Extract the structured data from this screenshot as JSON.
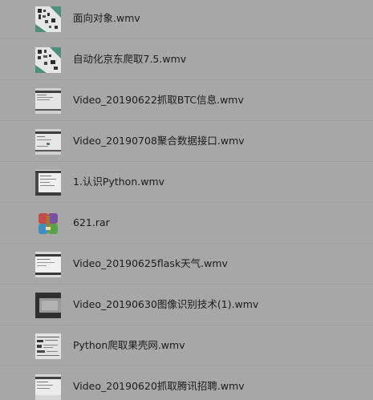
{
  "files": [
    {
      "name": "面向对象.wmv",
      "icon": "video-thumbnail-icon"
    },
    {
      "name": "自动化京东爬取7.5.wmv",
      "icon": "video-thumbnail-icon"
    },
    {
      "name": "Video_20190622抓取BTC信息.wmv",
      "icon": "video-thumbnail-icon"
    },
    {
      "name": "Video_20190708聚合数据接口.wmv",
      "icon": "video-thumbnail-icon"
    },
    {
      "name": "1.认识Python.wmv",
      "icon": "video-thumbnail-icon"
    },
    {
      "name": "621.rar",
      "icon": "archive-icon"
    },
    {
      "name": "Video_20190625flask天气.wmv",
      "icon": "video-thumbnail-icon"
    },
    {
      "name": "Video_20190630图像识别技术(1).wmv",
      "icon": "video-thumbnail-icon"
    },
    {
      "name": "Python爬取果壳网.wmv",
      "icon": "video-thumbnail-icon"
    },
    {
      "name": "Video_20190620抓取腾讯招聘.wmv",
      "icon": "video-thumbnail-icon"
    }
  ],
  "colors": {
    "background": "#a7a7a7",
    "divider": "#9d9d9d",
    "text": "#1c1c1c"
  }
}
